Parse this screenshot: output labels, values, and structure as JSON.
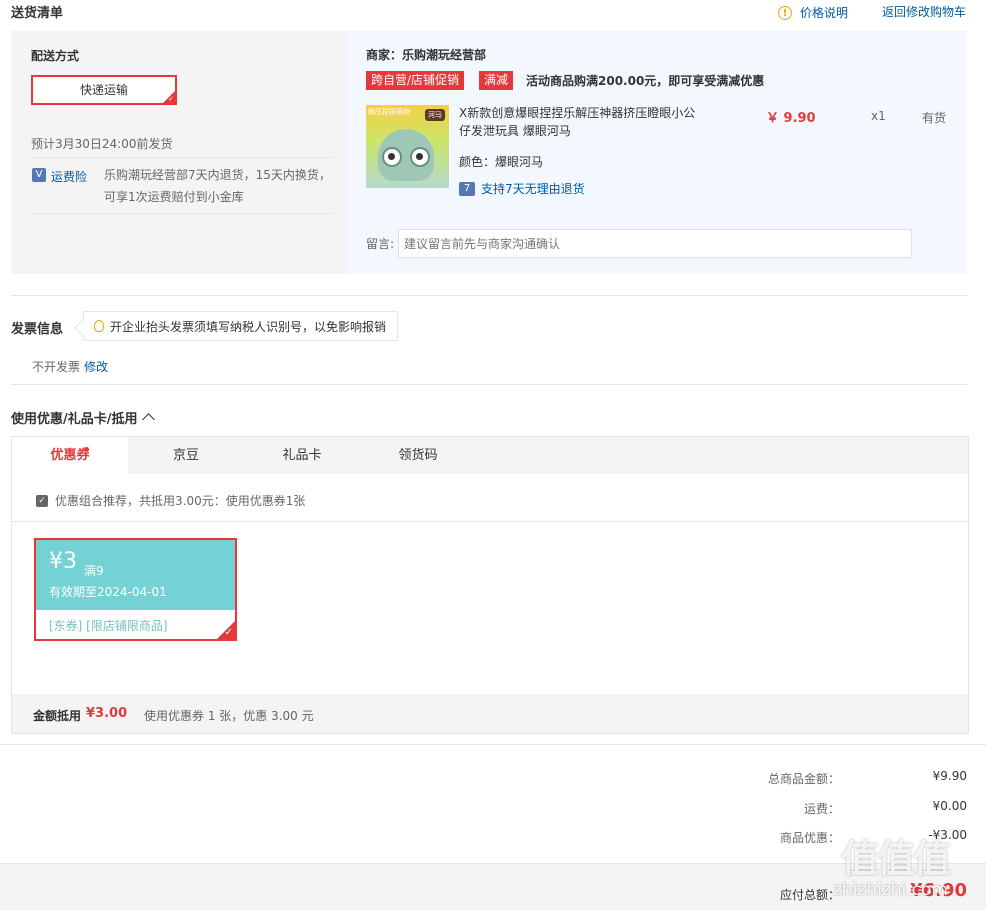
{
  "header": {
    "title": "送货清单",
    "price_explain": "价格说明",
    "back_to_cart": "返回修改购物车"
  },
  "shipping": {
    "title": "配送方式",
    "method": "快递运输",
    "estimate": "预计3月30日24:00前发货",
    "insurance_label": "运费险",
    "insurance_text": "乐购潮玩经营部7天内退货，15天内换货，可享1次运费赔付到小金库"
  },
  "merchant": {
    "name": "商家：乐购潮玩经营部",
    "tags": [
      "跨自营/店铺促销",
      "满减"
    ],
    "promo": "活动商品购满200.00元，即可享受满减优惠",
    "product": {
      "image_top_text": "解压捏捏萌物",
      "image_badge": "河马",
      "name": "X新款创意爆眼捏捏乐解压神器挤压瞪眼小公仔发泄玩具 爆眼河马",
      "price": "￥ 9.90",
      "qty": "x1",
      "stock": "有货",
      "color_label": "颜色：",
      "color_value": "爆眼河马",
      "return_icon": "7",
      "return_policy": "支持7天无理由退货"
    },
    "message_label": "留言:",
    "message_placeholder": "建议留言前先与商家沟通确认"
  },
  "invoice": {
    "title": "发票信息",
    "tip": "开企业抬头发票须填写纳税人识别号，以免影响报销",
    "status": "不开发票",
    "edit": "修改"
  },
  "coupons": {
    "title": "使用优惠/礼品卡/抵用",
    "tabs": [
      {
        "label": "优惠券"
      },
      {
        "label": "京豆"
      },
      {
        "label": "礼品卡"
      },
      {
        "label": "领货码"
      }
    ],
    "combo_text": "优惠组合推荐，共抵用3.00元：使用优惠券1张",
    "card": {
      "amount": "¥3",
      "condition": "满9",
      "valid": "有效期至2024-04-01",
      "scope": "[东券] [限店铺限商品]"
    },
    "footer": {
      "label": "金额抵用",
      "amount": "¥3.00",
      "desc": "使用优惠券 1 张，优惠 3.00 元"
    }
  },
  "summary": {
    "rows": [
      {
        "label": "总商品金额：",
        "value": "¥9.90"
      },
      {
        "label": "运费：",
        "value": "¥0.00"
      },
      {
        "label": "商品优惠：",
        "value": "-¥3.00"
      }
    ],
    "payable_label": "应付总额：",
    "payable_value": "¥6.90"
  },
  "watermark": {
    "logo": "值值值",
    "site": "zhizhizhi.com"
  },
  "colors": {
    "accent_red": "#e4393c",
    "link_blue": "#005aa0",
    "coupon_teal": "#74d2d4",
    "merchant_bg": "#f2f8fd"
  }
}
